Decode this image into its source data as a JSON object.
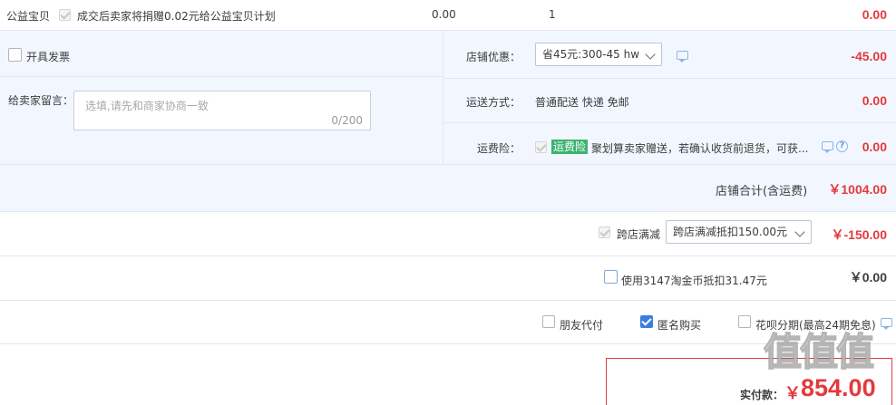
{
  "charity": {
    "label": "公益宝贝",
    "description": "成交后卖家将捐赠0.02元给公益宝贝计划",
    "unit_price": "0.00",
    "quantity": "1",
    "amount": "0.00"
  },
  "invoice": {
    "label": "开具发票"
  },
  "message": {
    "label": "给卖家留言：",
    "placeholder": "选填,请先和商家协商一致",
    "counter": "0/200"
  },
  "store_discount": {
    "label": "店铺优惠：",
    "selected": "省45元:300-45 hw",
    "amount": "-45.00"
  },
  "shipping": {
    "label": "运送方式：",
    "value": "普通配送 快递 免邮",
    "amount": "0.00"
  },
  "shipping_insurance": {
    "label": "运费险：",
    "badge": "运费险",
    "text": "聚划算卖家赠送，若确认收货前退货，可获...",
    "amount": "0.00"
  },
  "store_total": {
    "label": "店铺合计(含运费)",
    "amount": "￥1004.00"
  },
  "cross_store": {
    "label": "跨店满减",
    "selected": "跨店满减抵扣150.00元",
    "amount": "￥-150.00"
  },
  "taobao_coins": {
    "label": "使用3147淘金币抵扣31.47元",
    "amount": "￥0.00"
  },
  "options": {
    "friend_pay": "朋友代付",
    "anonymous": "匿名购买",
    "huabei": "花呗分期(最高24期免息)"
  },
  "total": {
    "label": "实付款：",
    "currency": "￥",
    "amount": "854.00"
  },
  "watermark": "值值值",
  "colors": {
    "accent_red": "#e4393c",
    "panel_blue": "#f2f7ff",
    "badge_green": "#3cb371",
    "checkbox_blue": "#3a7de0"
  }
}
